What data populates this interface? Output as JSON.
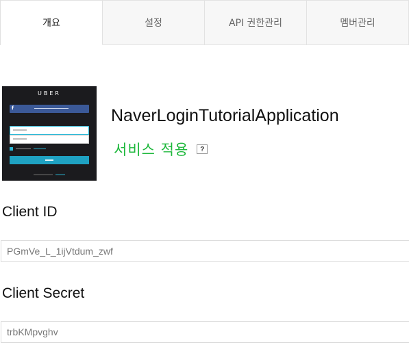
{
  "tabs": [
    {
      "label": "개요",
      "active": true
    },
    {
      "label": "설정",
      "active": false
    },
    {
      "label": "API 권한관리",
      "active": false
    },
    {
      "label": "멤버관리",
      "active": false
    }
  ],
  "app": {
    "name": "NaverLoginTutorialApplication",
    "status": "서비스 적용",
    "status_color": "#1eb83c",
    "help_label": "?",
    "thumbnail": {
      "brand": "UBER"
    }
  },
  "credentials": {
    "client_id_label": "Client ID",
    "client_id_value": "PGmVe_L_1ijVtdum_zwf",
    "client_secret_label": "Client Secret",
    "client_secret_value": "trbKMpvghv"
  }
}
